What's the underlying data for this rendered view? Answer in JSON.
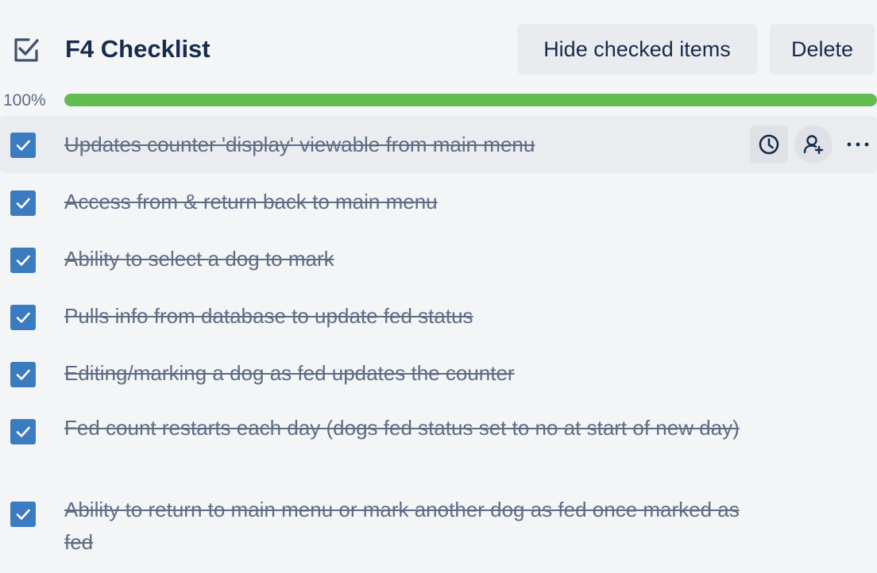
{
  "checklist": {
    "title": "F4 Checklist",
    "hide_checked_label": "Hide checked items",
    "delete_label": "Delete",
    "progress_label": "100%",
    "progress_fraction": 1.0,
    "progress_color": "#61bd4f",
    "checkbox_color": "#3b7bbf"
  },
  "items": [
    {
      "text": "Updates counter 'display' viewable from main menu",
      "checked": true
    },
    {
      "text": "Access from & return back to main menu",
      "checked": true
    },
    {
      "text": "Ability to select a dog to mark",
      "checked": true
    },
    {
      "text": "Pulls info from database to update fed status",
      "checked": true
    },
    {
      "text": "Editing/marking a dog as fed updates the counter",
      "checked": true
    },
    {
      "text": "Fed count restarts each day (dogs fed status set to no at start of new day)",
      "checked": true
    },
    {
      "text": "Ability to return to main menu or mark another dog as fed once marked as fed",
      "checked": true
    }
  ],
  "item_actions": {
    "icons": [
      "clock-icon",
      "add-member-icon",
      "more-icon"
    ]
  }
}
